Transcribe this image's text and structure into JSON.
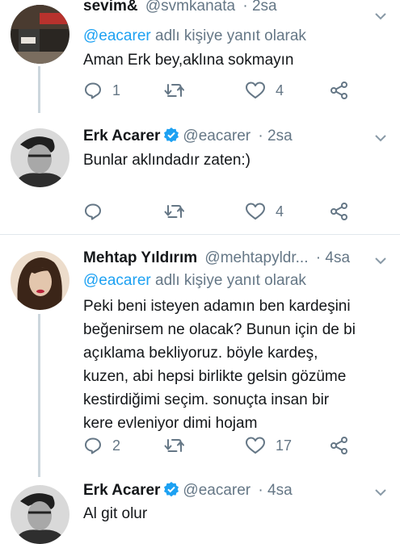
{
  "colors": {
    "link": "#1da1f2",
    "muted": "#657786",
    "text": "#14171a",
    "verified": "#1da1f2",
    "divider": "#e1e8ed"
  },
  "tweets": [
    {
      "name": "sevim&",
      "handle": "@svmkanata",
      "time": "· 2sa",
      "verified": false,
      "reply_prefix": "@eacarer",
      "reply_suffix": " adlı kişiye yanıt olarak",
      "text": [
        "Aman Erk bey,aklına sokmayın"
      ],
      "replies": "1",
      "retweets": "",
      "likes": "4"
    },
    {
      "name": "Erk Acarer",
      "handle": "@eacarer",
      "time": "· 2sa",
      "verified": true,
      "text": [
        "Bunlar aklındadır zaten:)"
      ],
      "replies": "",
      "retweets": "",
      "likes": "4"
    },
    {
      "name": "Mehtap Yıldırım",
      "handle": "@mehtapyldr...",
      "time": "· 4sa",
      "verified": false,
      "reply_prefix": "@eacarer",
      "reply_suffix": " adlı kişiye yanıt olarak",
      "text": [
        "Peki beni isteyen adamın ben kardeşini",
        "beğenirsem ne olacak? Bunun için de bi",
        "açıklama bekliyoruz. böyle kardeş,",
        "kuzen, abi hepsi birlikte gelsin gözüme",
        "kestirdiğimi seçim. sonuçta insan bir",
        "kere evleniyor dimi hojam"
      ],
      "replies": "2",
      "retweets": "",
      "likes": "17"
    },
    {
      "name": "Erk Acarer",
      "handle": "@eacarer",
      "time": "· 4sa",
      "verified": true,
      "text": [
        "Al git olur"
      ]
    }
  ]
}
